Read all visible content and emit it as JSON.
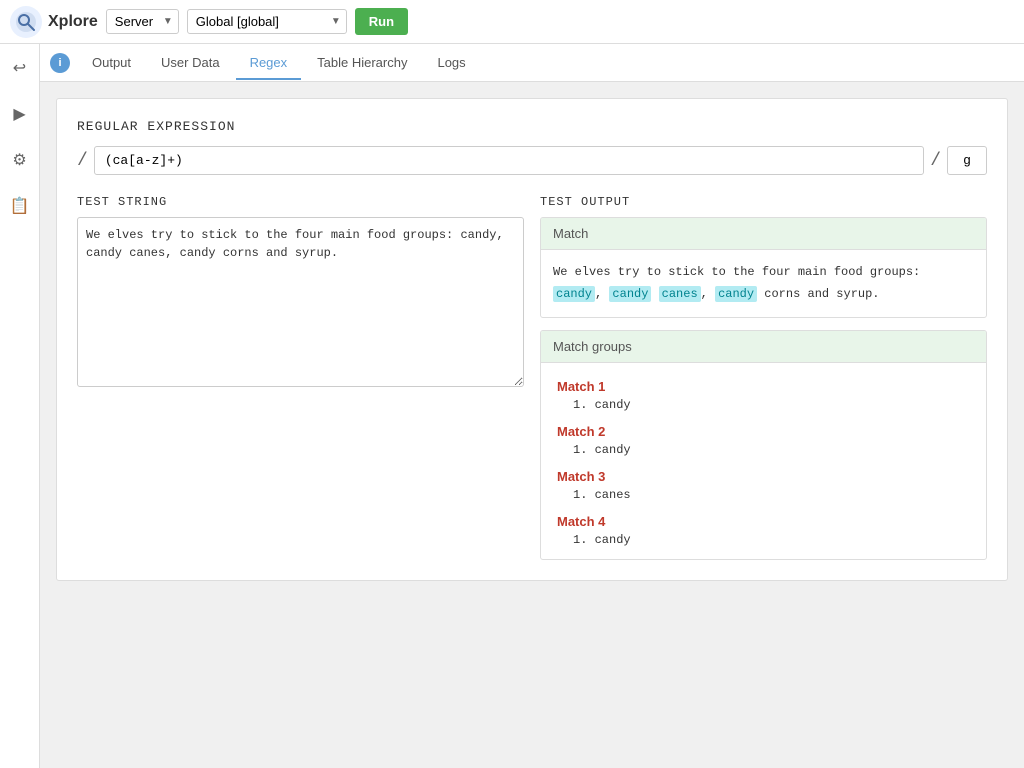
{
  "app": {
    "logo_text": "Xplore",
    "server_label": "Server",
    "global_label": "Global [global]",
    "run_label": "Run"
  },
  "tabs": [
    {
      "id": "output",
      "label": "Output",
      "active": false
    },
    {
      "id": "user-data",
      "label": "User Data",
      "active": false
    },
    {
      "id": "regex",
      "label": "Regex",
      "active": true
    },
    {
      "id": "table-hierarchy",
      "label": "Table Hierarchy",
      "active": false
    },
    {
      "id": "logs",
      "label": "Logs",
      "active": false
    }
  ],
  "regex": {
    "section_title": "REGULAR EXPRESSION",
    "slash_open": "/",
    "slash_close": "/",
    "pattern": "(ca[a-z]+)",
    "flag": "g",
    "test_string_title": "TEST STRING",
    "test_string": "We elves try to stick to the four main food groups: candy,\ncandy canes, candy corns and syrup.",
    "test_output_title": "TEST OUTPUT",
    "match_header": "Match",
    "match_text_before": "We elves try to stick to the four main food groups: ",
    "match_highlights": [
      "candy",
      "candy",
      "canes",
      "candy"
    ],
    "match_text_after": " corns and syrup.",
    "match_groups_header": "Match groups",
    "matches": [
      {
        "title": "Match 1",
        "items": [
          "1. candy"
        ]
      },
      {
        "title": "Match 2",
        "items": [
          "1. candy"
        ]
      },
      {
        "title": "Match 3",
        "items": [
          "1. canes"
        ]
      },
      {
        "title": "Match 4",
        "items": [
          "1. candy"
        ]
      }
    ]
  },
  "sidebar_icons": [
    "↩",
    "▶",
    "⚙",
    "📋"
  ]
}
